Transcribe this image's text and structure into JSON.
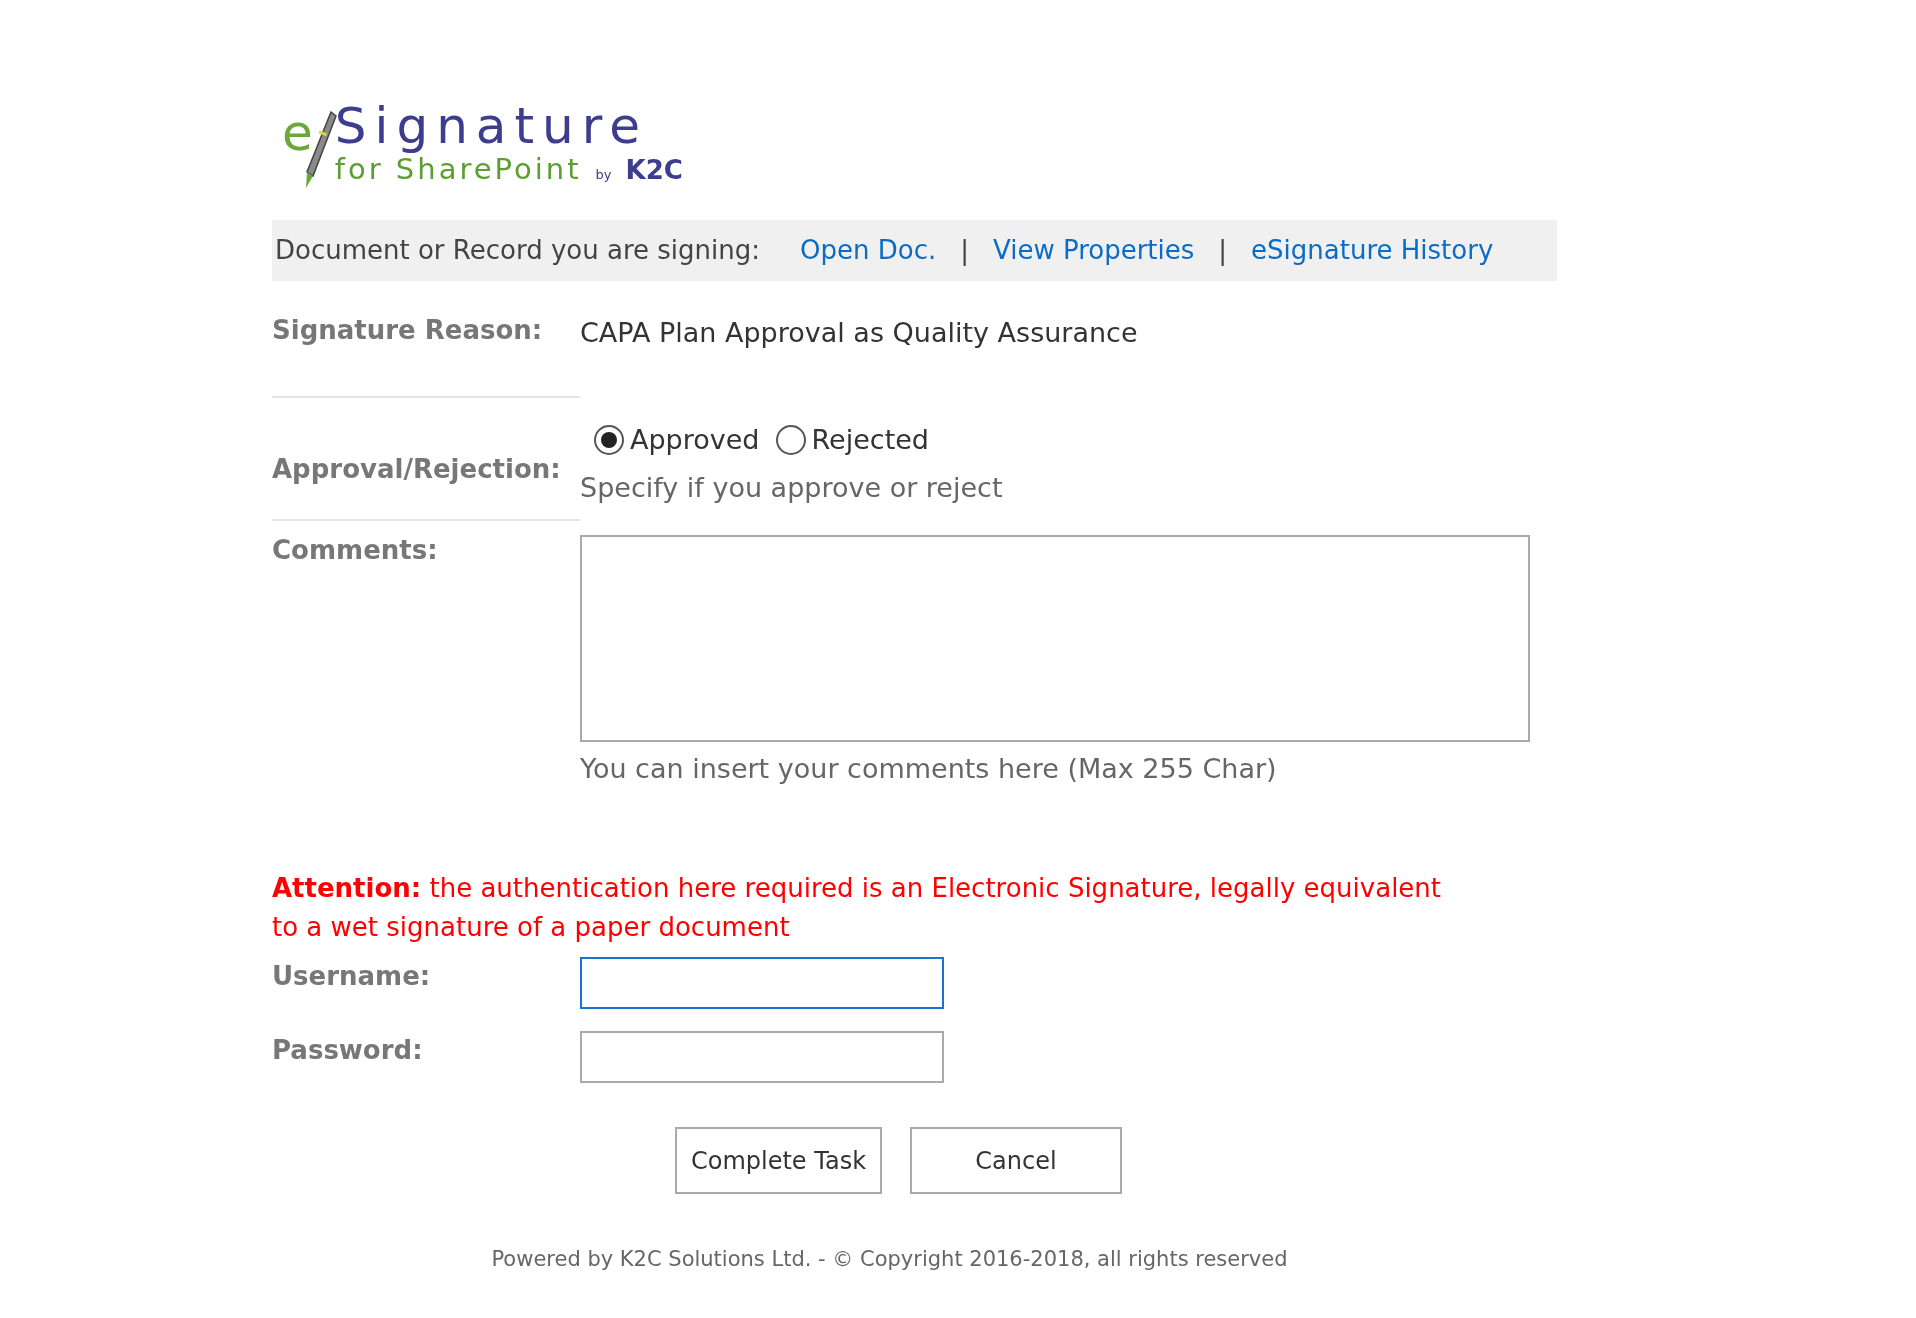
{
  "logo": {
    "prefix": "e",
    "title": "Signature",
    "subtitle": "for SharePoint",
    "by": "by",
    "brand": "K2C"
  },
  "document_bar": {
    "label": "Document or Record you are signing:",
    "links": [
      {
        "label": "Open Doc."
      },
      {
        "label": "View Properties"
      },
      {
        "label": "eSignature History"
      }
    ],
    "separator": "|"
  },
  "signature_reason": {
    "label": "Signature Reason:",
    "value": "CAPA Plan Approval as Quality Assurance"
  },
  "approval": {
    "label": "Approval/Rejection:",
    "options": [
      {
        "label": "Approved",
        "selected": true
      },
      {
        "label": "Rejected",
        "selected": false
      }
    ],
    "hint": "Specify if you approve or reject"
  },
  "comments": {
    "label": "Comments:",
    "hint": "You can insert your comments here (Max 255 Char)"
  },
  "attention": "**Attention:** the authentication here required is an Electronic Signature, legally equivalent to a wet signature of a paper document",
  "credentials": [
    {
      "label": "Username:",
      "focused": true
    },
    {
      "label": "Password:",
      "focused": false
    }
  ],
  "buttons": [
    "Complete Task",
    "Cancel"
  ],
  "footer": "Powered by K2C Solutions Ltd. - © Copyright 2016-2018, all rights reserved"
}
